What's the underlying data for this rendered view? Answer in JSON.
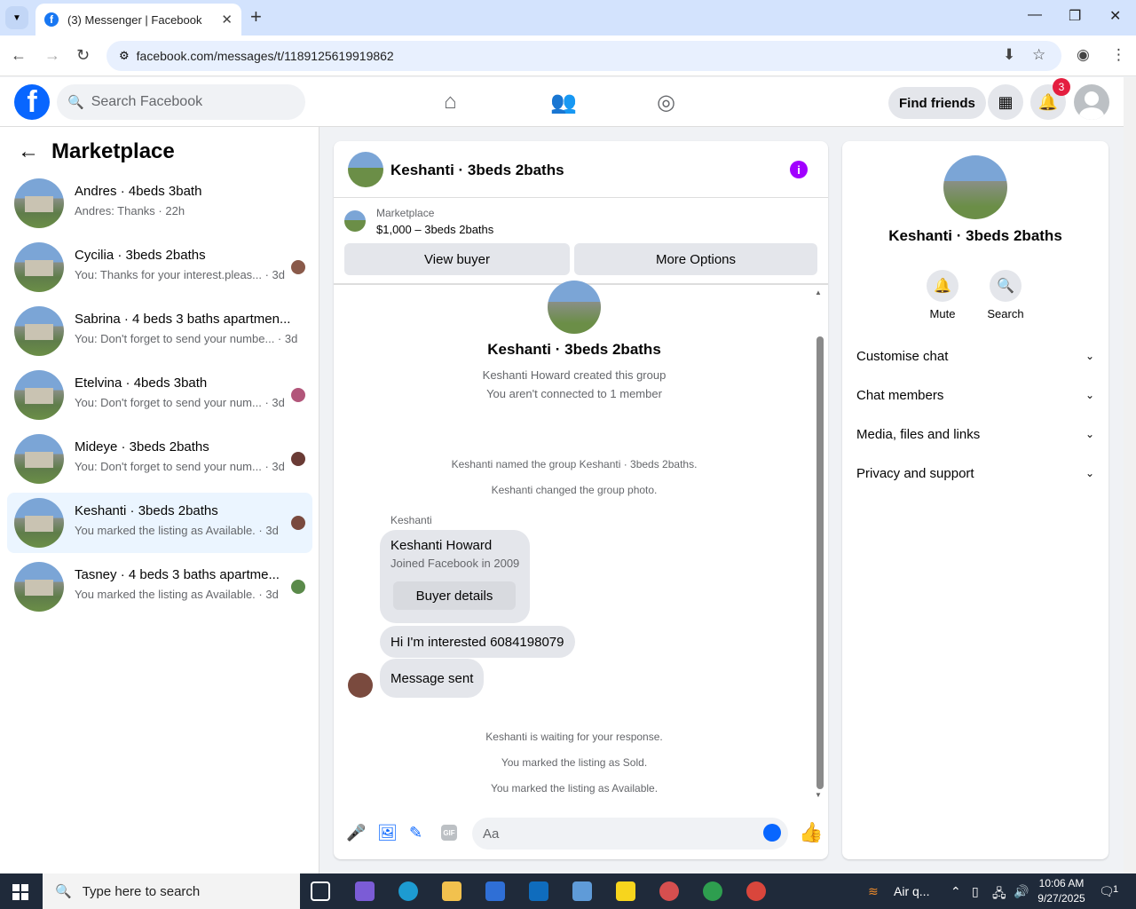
{
  "browser": {
    "tab_title": "(3) Messenger | Facebook",
    "url": "facebook.com/messages/t/1189125619919862",
    "new_tab": "+"
  },
  "fb": {
    "logo": "f",
    "search_placeholder": "Search Facebook",
    "find_friends": "Find friends",
    "notif_count": "3"
  },
  "left": {
    "title": "Marketplace",
    "conversations": [
      {
        "name": "Andres · 4beds 3bath",
        "sub": "Andres: Thanks · 22h"
      },
      {
        "name": "Cycilia · 3beds 2baths",
        "sub": "You: Thanks for your interest.pleas... · 3d"
      },
      {
        "name": "Sabrina · 4 beds 3 baths apartmen...",
        "sub": "You: Don't forget to send your numbe... · 3d"
      },
      {
        "name": "Etelvina · 4beds 3bath",
        "sub": "You: Don't forget to send your num... · 3d"
      },
      {
        "name": "Mideye · 3beds 2baths",
        "sub": "You: Don't forget to send your num... · 3d"
      },
      {
        "name": "Keshanti · 3beds 2baths",
        "sub": "You marked the listing as Available. · 3d"
      },
      {
        "name": "Tasney · 4 beds 3 baths apartme...",
        "sub": "You marked the listing as Available. · 3d"
      }
    ]
  },
  "chat": {
    "title": "Keshanti · 3beds 2baths",
    "marketplace_label": "Marketplace",
    "price": "$1,000 – 3beds 2baths",
    "view_buyer": "View buyer",
    "more_options": "More Options",
    "group_name": "Keshanti · 3beds 2baths",
    "created": "Keshanti Howard created this group",
    "not_connected": "You aren't connected to 1 member",
    "named": "Keshanti named the group Keshanti · 3beds 2baths.",
    "changed_photo": "Keshanti changed the group photo.",
    "sender": "Keshanti",
    "card_name": "Keshanti Howard",
    "card_joined": "Joined Facebook in 2009",
    "buyer_details": "Buyer details",
    "msg1": "Hi I'm interested 6084198079",
    "msg2": "Message sent",
    "waiting": "Keshanti is waiting for your response.",
    "sold": "You marked the listing as Sold.",
    "available": "You marked the listing as Available.",
    "composer_placeholder": "Aa",
    "gif": "GIF"
  },
  "info": {
    "name": "Keshanti · 3beds 2baths",
    "mute": "Mute",
    "search": "Search",
    "sections": [
      "Customise chat",
      "Chat members",
      "Media, files and links",
      "Privacy and support"
    ]
  },
  "taskbar": {
    "search_placeholder": "Type here to search",
    "weather": "Air q...",
    "time": "10:06 AM",
    "date": "9/27/2025",
    "notif": "1"
  }
}
